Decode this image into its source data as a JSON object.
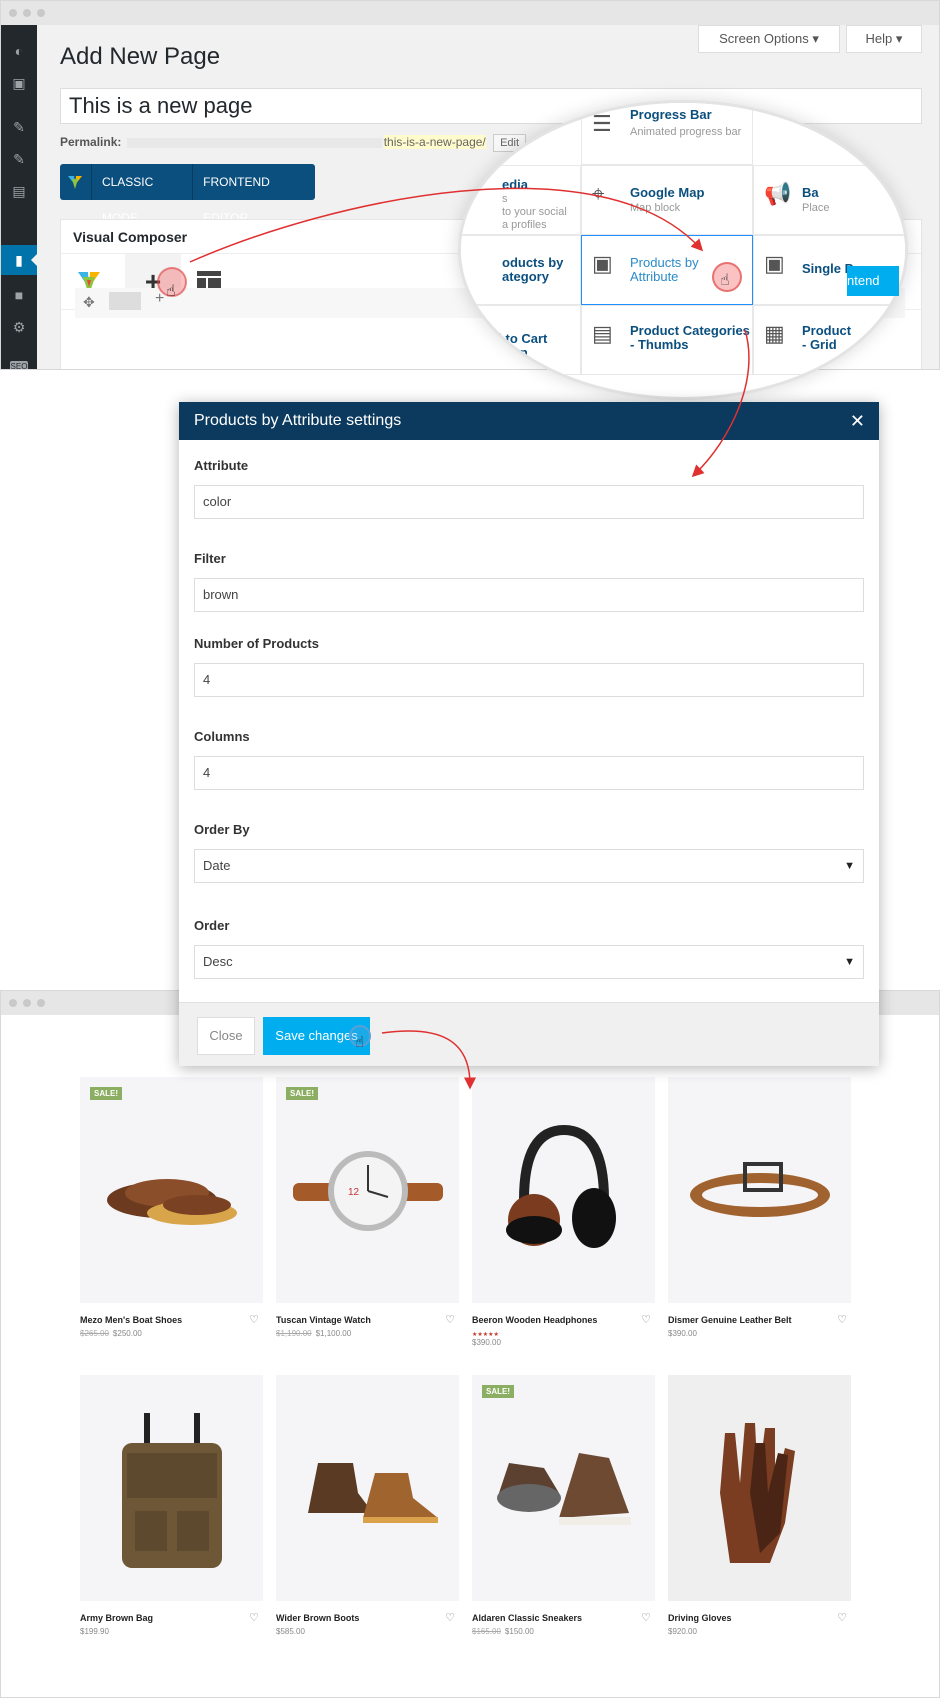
{
  "top_window": {
    "screen_options": "Screen Options",
    "help": "Help",
    "page_title": "Add New Page",
    "title_value": "This is a new page",
    "permalink_label": "Permalink:",
    "permalink_slug": "this-is-a-new-page/",
    "edit_label": "Edit",
    "classic_mode": "CLASSIC MODE",
    "frontend_editor": "FRONTEND EDITOR",
    "vc_title": "Visual Composer",
    "frontend_btn": "ntend"
  },
  "magnifier": {
    "cells": [
      {
        "caption": "Progress Bar",
        "sub": "Animated progress bar"
      },
      {
        "caption": "edia",
        "sub": "s"
      },
      {
        "caption": "Google Map",
        "sub": "Map block"
      },
      {
        "caption": "Ba",
        "sub": "Place"
      },
      {
        "caption": "oducts by",
        "caption2": "ategory",
        "sub": ""
      },
      {
        "caption": "Products by",
        "caption2": "Attribute",
        "sub": ""
      },
      {
        "caption": "Single P",
        "sub": ""
      },
      {
        "caption": "dd to Cart Button",
        "sub": ""
      },
      {
        "caption": "Product Categories",
        "caption2": "- Thumbs",
        "sub": ""
      },
      {
        "caption": "Product",
        "caption2": "- Grid",
        "sub": ""
      }
    ],
    "social_sub1": "to your social",
    "social_sub2": "a profiles"
  },
  "modal": {
    "title": "Products by Attribute settings",
    "fields": [
      {
        "label": "Attribute",
        "value": "color"
      },
      {
        "label": "Filter",
        "value": "brown"
      },
      {
        "label": "Number of Products",
        "value": "4"
      },
      {
        "label": "Columns",
        "value": "4"
      },
      {
        "label": "Order By",
        "value": "Date"
      },
      {
        "label": "Order",
        "value": "Desc"
      }
    ],
    "close_label": "Close",
    "save_label": "Save changes"
  },
  "products": [
    {
      "name": "Mezo Men's Boat Shoes",
      "old_price": "$265.00",
      "price": "$250.00",
      "sale": "SALE!"
    },
    {
      "name": "Tuscan Vintage Watch",
      "old_price": "$1,190.00",
      "price": "$1,100.00",
      "sale": "SALE!"
    },
    {
      "name": "Beeron Wooden Headphones",
      "old_price": "",
      "price": "$390.00",
      "sale": "",
      "stars": "★★★★★"
    },
    {
      "name": "Dismer Genuine Leather Belt",
      "old_price": "",
      "price": "$390.00",
      "sale": ""
    },
    {
      "name": "Army Brown Bag",
      "old_price": "",
      "price": "$199.90",
      "sale": ""
    },
    {
      "name": "Wider Brown Boots",
      "old_price": "",
      "price": "$585.00",
      "sale": ""
    },
    {
      "name": "Aldaren Classic Sneakers",
      "old_price": "$165.00",
      "price": "$150.00",
      "sale": "SALE!"
    },
    {
      "name": "Driving Gloves",
      "old_price": "",
      "price": "$920.00",
      "sale": ""
    }
  ],
  "colors": {
    "wp_dark": "#23282d",
    "vc_blue": "#0b4f7f",
    "modal_head": "#0b3a5e",
    "accent": "#00aef0",
    "sale_green": "#8bae62",
    "arrow_red": "#e03030"
  }
}
